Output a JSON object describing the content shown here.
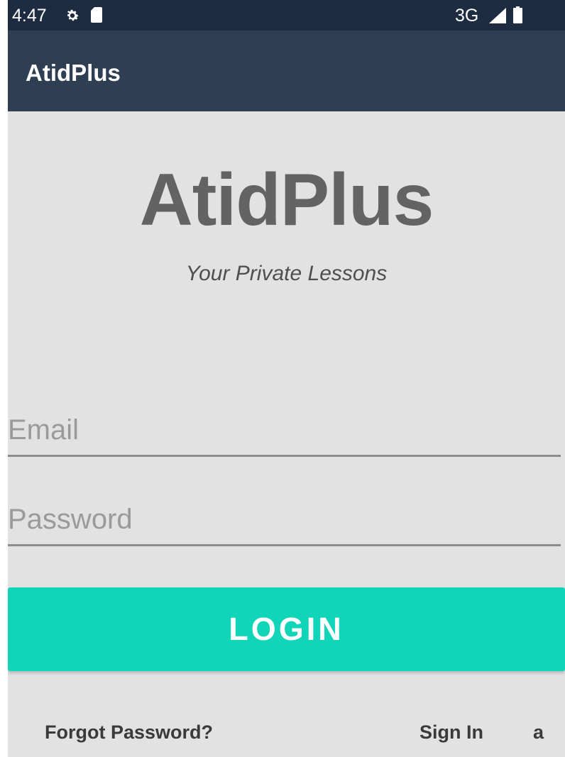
{
  "status_bar": {
    "time": "4:47",
    "network": "3G",
    "icons": [
      "gear-icon",
      "sd-card-icon",
      "signal-icon",
      "battery-icon"
    ]
  },
  "app_bar": {
    "title": "AtidPlus"
  },
  "hero": {
    "logo_text": "AtidPlus",
    "tagline": "Your Private Lessons"
  },
  "form": {
    "email_placeholder": "Email",
    "email_value": "",
    "password_placeholder": "Password",
    "password_value": "",
    "login_label": "LOGIN"
  },
  "footer": {
    "forgot_password_label": "Forgot Password?",
    "sign_in_label": "Sign In",
    "extra_label": "a"
  },
  "colors": {
    "status_bar": "#1d2c40",
    "app_bar": "#2e3e53",
    "background": "#e2e2e2",
    "login_button": "#10d5b8",
    "logo_text": "#636363"
  }
}
